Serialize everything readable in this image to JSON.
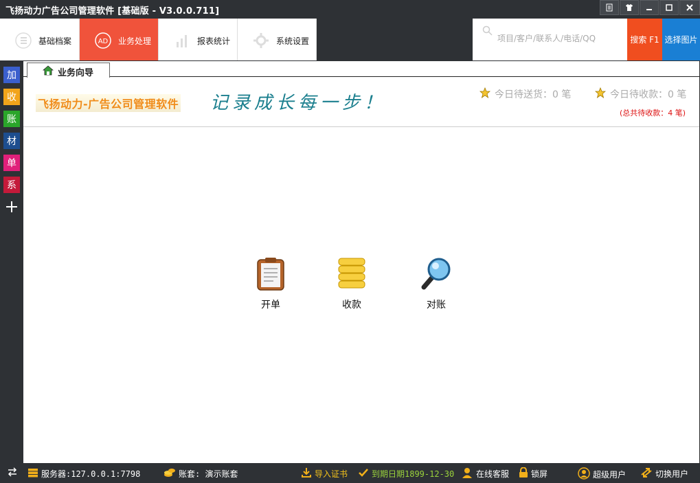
{
  "window": {
    "title": "飞扬动力广告公司管理软件 [基础版 - V3.0.0.711]",
    "buttons": [
      "notes",
      "skin",
      "minimize",
      "maximize",
      "close"
    ]
  },
  "nav": {
    "tabs": [
      {
        "label": "基础档案",
        "icon": "list-icon",
        "active": false
      },
      {
        "label": "业务处理",
        "icon": "ad-icon",
        "active": true
      },
      {
        "label": "报表统计",
        "icon": "bar-chart-icon",
        "active": false
      },
      {
        "label": "系统设置",
        "icon": "gear-icon",
        "active": false
      }
    ],
    "search_placeholder": "项目/客户/联系人/电话/QQ",
    "search_button": "搜索 F1",
    "pic_button": "选择图片"
  },
  "quickbar": [
    {
      "label": "加",
      "color": "#3a5fcd"
    },
    {
      "label": "收",
      "color": "#f2a41a"
    },
    {
      "label": "账",
      "color": "#2aa52a"
    },
    {
      "label": "材",
      "color": "#1d4e8f"
    },
    {
      "label": "单",
      "color": "#e0207a"
    },
    {
      "label": "系",
      "color": "#c41a3a"
    },
    {
      "label": "+",
      "color": "transparent"
    }
  ],
  "doc_tab": {
    "label": "业务向导"
  },
  "banner": {
    "brand": "飞扬动力-广告公司管理软件",
    "slogan": "记录成长每一步！",
    "today_delivery": "今日待送货：0 笔",
    "today_receivable": "今日待收款：0 笔",
    "total_receivable": "(总共待收款：4 笔)"
  },
  "actions": [
    {
      "label": "开单",
      "icon": "clipboard-icon"
    },
    {
      "label": "收款",
      "icon": "coins-icon"
    },
    {
      "label": "对账",
      "icon": "magnifier-icon"
    }
  ],
  "status": {
    "server": "服务器:127.0.0.1:7798",
    "account": "账套: 演示账套",
    "import_cert": "导入证书",
    "expiry": "到期日期1899-12-30",
    "support": "在线客服",
    "lock": "锁屏",
    "user": "超级用户",
    "switch_user": "切换用户"
  }
}
